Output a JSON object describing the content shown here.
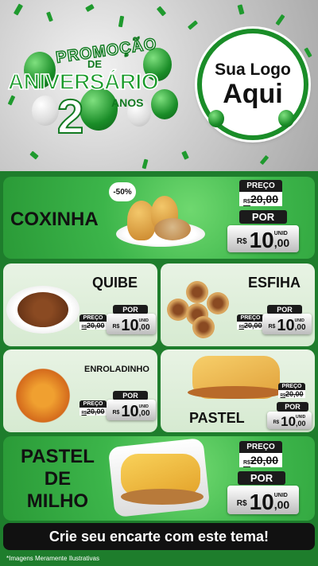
{
  "header": {
    "promo_top": "PROMOÇÃO",
    "promo_de": "DE",
    "promo_title": "ANIVERSÁRIO",
    "promo_number": "2",
    "promo_years": "ANOS",
    "logo_line1": "Sua Logo",
    "logo_line2": "Aqui"
  },
  "colors": {
    "brand_green": "#1a8d28",
    "panel_green": "#3cb54a",
    "dark": "#111111"
  },
  "labels": {
    "price": "PREÇO",
    "por": "POR",
    "unid": "UNID",
    "currency": "R$"
  },
  "products": [
    {
      "name": "COXINHA",
      "old_price": "20,00",
      "old_currency": "R$",
      "price_int": "10",
      "price_dec": ",00",
      "badge": "-50%"
    },
    {
      "name": "QUIBE",
      "old_price": "20,00",
      "old_currency": "R$",
      "price_int": "10",
      "price_dec": ",00"
    },
    {
      "name": "ESFIHA",
      "old_price": "20,00",
      "old_currency": "R$",
      "price_int": "10",
      "price_dec": ",00"
    },
    {
      "name": "ENROLADINHO",
      "old_price": "20,00",
      "old_currency": "R$",
      "price_int": "10",
      "price_dec": ",00"
    },
    {
      "name": "PASTEL",
      "old_price": "20,00",
      "old_currency": "R$",
      "price_int": "10",
      "price_dec": ",00"
    },
    {
      "name_lines": [
        "PASTEL",
        "DE",
        "MILHO"
      ],
      "old_price": "20,00",
      "old_currency": "R$",
      "price_int": "10",
      "price_dec": ",00"
    }
  ],
  "footer": {
    "cta": "Crie seu encarte com este tema!",
    "disclaimer": "*Imagens Meramente Ilustrativas"
  }
}
